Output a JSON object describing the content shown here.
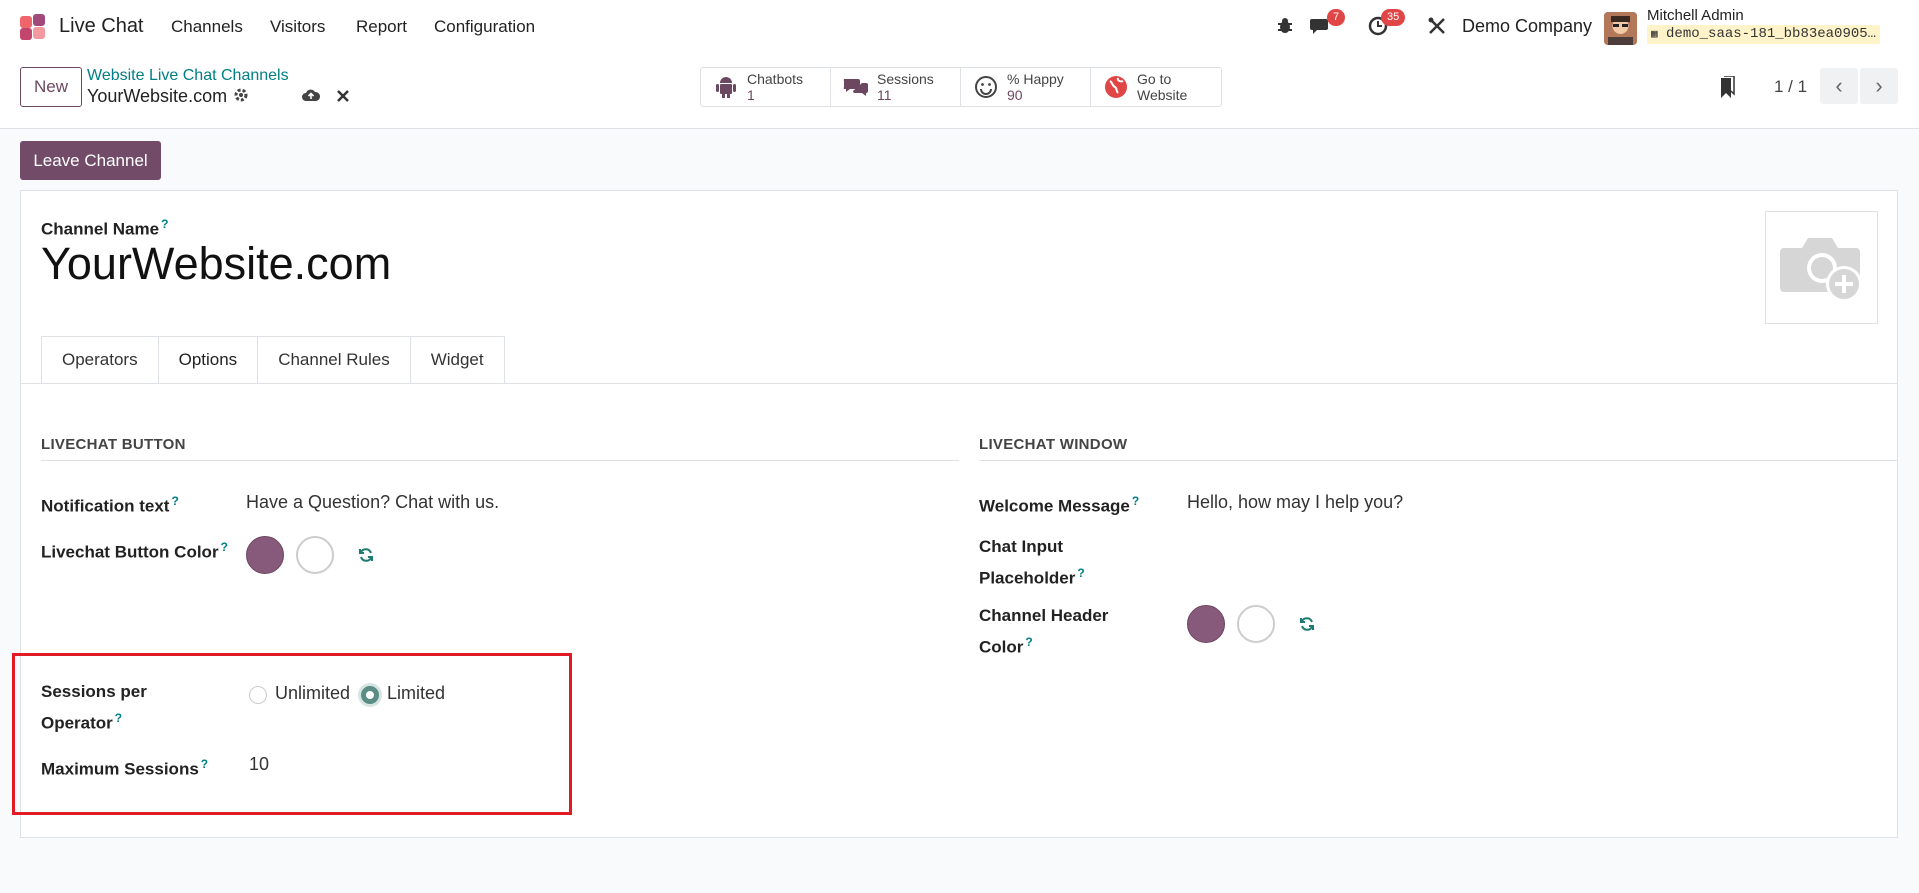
{
  "nav": {
    "app_name": "Live Chat",
    "menu": [
      "Channels",
      "Visitors",
      "Report",
      "Configuration"
    ],
    "messages_count": "7",
    "activities_count": "35",
    "company": "Demo Company",
    "user_name": "Mitchell Admin",
    "database": "demo_saas-181_bb83ea0905…"
  },
  "control_panel": {
    "new_label": "New",
    "breadcrumb_parent": "Website Live Chat Channels",
    "breadcrumb_current": "YourWebsite.com",
    "smart_buttons": [
      {
        "label": "Chatbots",
        "value": "1",
        "icon": "android-icon"
      },
      {
        "label": "Sessions",
        "value": "11",
        "icon": "comments-icon"
      },
      {
        "label": "% Happy",
        "value": "90",
        "icon": "smile-icon"
      },
      {
        "label": "Go to",
        "value": "Website",
        "icon": "globe-icon"
      }
    ],
    "pager": "1 / 1"
  },
  "actions": {
    "leave_channel": "Leave Channel"
  },
  "form": {
    "channel_name_label": "Channel Name",
    "channel_name": "YourWebsite.com",
    "tabs": [
      "Operators",
      "Options",
      "Channel Rules",
      "Widget"
    ],
    "active_tab": "Options",
    "livechat_button": {
      "section_title": "LIVECHAT BUTTON",
      "notification_label": "Notification text",
      "notification_value": "Have a Question? Chat with us.",
      "button_color_label": "Livechat Button Color",
      "button_color": "#875a7b",
      "button_text_color": "#ffffff"
    },
    "livechat_window": {
      "section_title": "LIVECHAT WINDOW",
      "welcome_label": "Welcome Message",
      "welcome_value": "Hello, how may I help you?",
      "placeholder_label_1": "Chat Input",
      "placeholder_label_2": "Placeholder",
      "header_color_label_1": "Channel Header",
      "header_color_label_2": "Color",
      "header_color": "#875a7b",
      "header_text_color": "#ffffff"
    },
    "sessions": {
      "label_1": "Sessions per",
      "label_2": "Operator",
      "option_unlimited": "Unlimited",
      "option_limited": "Limited",
      "selected": "Limited",
      "max_label": "Maximum Sessions",
      "max_value": "10"
    }
  },
  "colors": {
    "brand": "#714b67",
    "link": "#017e84",
    "badge": "#e04646",
    "highlight": "#e01b24"
  }
}
